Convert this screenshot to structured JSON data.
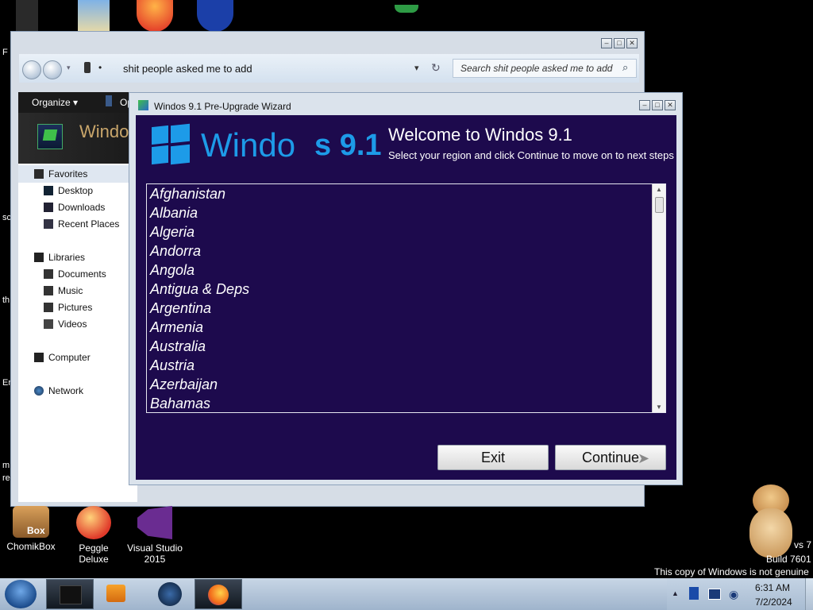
{
  "explorer": {
    "address_path": "shit people asked me to add",
    "search_placeholder": "Search shit people asked me to add",
    "toolbar": {
      "organize_label": "Organize ▾",
      "partial_label": "Op"
    },
    "banner_title": "Windo",
    "nav": {
      "favorites": "Favorites",
      "desktop": "Desktop",
      "downloads": "Downloads",
      "recent_places": "Recent Places",
      "libraries": "Libraries",
      "documents": "Documents",
      "music": "Music",
      "pictures": "Pictures",
      "videos": "Videos",
      "computer": "Computer",
      "network": "Network"
    }
  },
  "wizard": {
    "window_title": "Windos 9.1 Pre-Upgrade Wizard",
    "logo_text_a": "Windo",
    "logo_text_b": "s 9.1",
    "heading": "Welcome to Windos 9.1",
    "subheading": "Select your region and click Continue to move on to next steps",
    "countries": [
      "Afghanistan",
      "Albania",
      "Algeria",
      "Andorra",
      "Angola",
      "Antigua & Deps",
      "Argentina",
      "Armenia",
      "Australia",
      "Austria",
      "Azerbaijan",
      "Bahamas"
    ],
    "exit_label": "Exit",
    "continue_label": "Continue"
  },
  "desktop_icons": [
    {
      "label": "ChomikBox"
    },
    {
      "label": "Peggle Deluxe"
    },
    {
      "label": "Visual Studio 2015"
    }
  ],
  "watermark": {
    "line1": "vs 7",
    "line2": "Build 7601",
    "line3": "This copy of Windows is not genuine"
  },
  "clock": {
    "time": "6:31 AM",
    "date": "7/2/2024"
  },
  "side_fragments": [
    "F",
    "sc",
    "th",
    "Er",
    "m",
    "re"
  ],
  "colors": {
    "wizard_bg": "#1d0a4d",
    "logo_blue": "#1d9be8"
  }
}
